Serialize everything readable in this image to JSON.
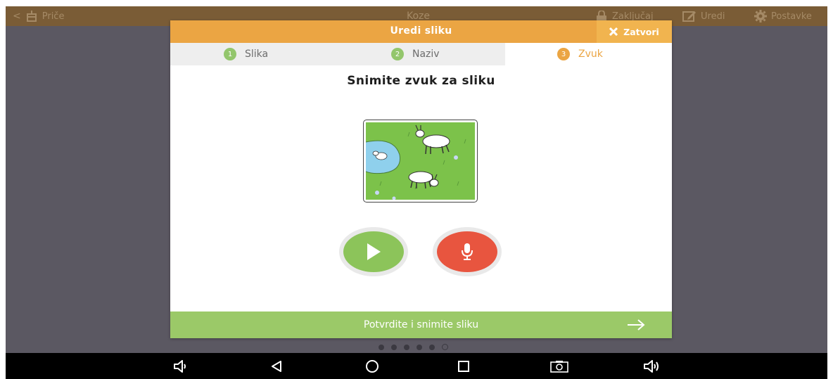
{
  "app": {
    "back_label": "Priče",
    "title": "Koze",
    "lock_label": "Zaključaj",
    "edit_label": "Uredi",
    "settings_label": "Postavke"
  },
  "modal": {
    "title": "Uredi sliku",
    "close_label": "Zatvori",
    "tabs": [
      {
        "number": "1",
        "label": "Slika"
      },
      {
        "number": "2",
        "label": "Naziv"
      },
      {
        "number": "3",
        "label": "Zvuk"
      }
    ],
    "heading": "Snimite zvuk za sliku",
    "picture": "goats-grazing-by-pond",
    "confirm_label": "Potvrdite i snimite sliku"
  },
  "page_dots": {
    "count": 6,
    "active_index": 5
  },
  "colors": {
    "header": "#eba543",
    "play": "#8cc45a",
    "record": "#e8553f",
    "confirm": "#9bc968",
    "topbar": "#7a5c36",
    "background": "#5b5862"
  },
  "icons": [
    "back-chevron-icon",
    "story-icon",
    "lock-icon",
    "edit-icon",
    "gear-icon",
    "close-icon",
    "play-icon",
    "microphone-icon",
    "arrow-right-icon",
    "volume-down-icon",
    "back-icon",
    "home-icon",
    "recents-icon",
    "screenshot-icon",
    "volume-up-icon"
  ]
}
